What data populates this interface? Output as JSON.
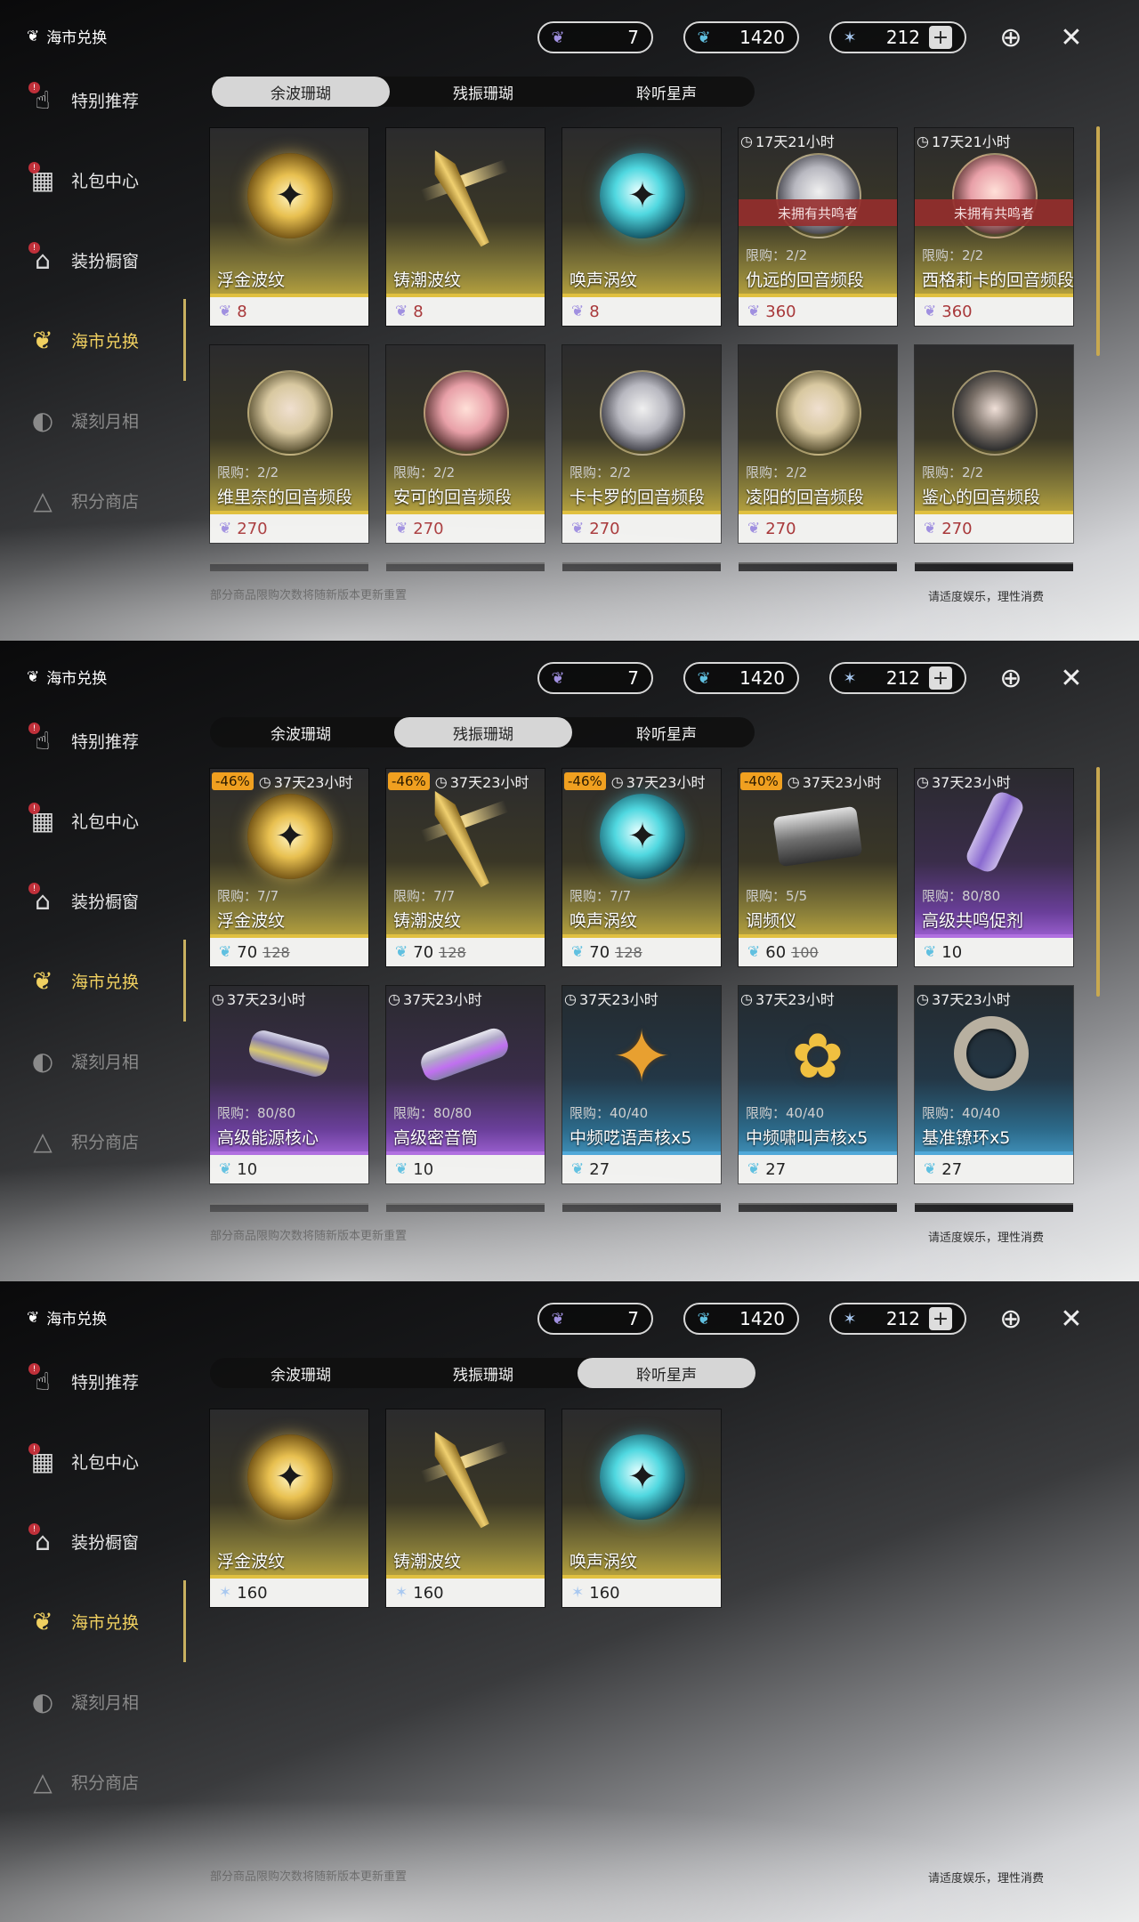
{
  "sidebar": {
    "title": "海市兑换",
    "items": [
      {
        "label": "特别推荐",
        "icon": "star-hand-icon",
        "badge": "!"
      },
      {
        "label": "礼包中心",
        "icon": "gift-icon",
        "badge": "!"
      },
      {
        "label": "装扮橱窗",
        "icon": "wardrobe-icon",
        "badge": "!"
      },
      {
        "label": "海市兑换",
        "icon": "coral-icon",
        "badge": ""
      },
      {
        "label": "凝刻月相",
        "icon": "moon-icon",
        "badge": ""
      },
      {
        "label": "积分商店",
        "icon": "triangle-shop-icon",
        "badge": ""
      }
    ],
    "active_index": 3
  },
  "currencies": [
    {
      "name": "余波珊瑚",
      "icon": "coral-purple-icon",
      "value": "7"
    },
    {
      "name": "残振珊瑚",
      "icon": "coral-blue-icon",
      "value": "1420"
    },
    {
      "name": "星声",
      "icon": "astrite-icon",
      "value": "212"
    }
  ],
  "plus_label": "+",
  "top_icons": [
    "target-icon",
    "close-icon"
  ],
  "tabs": [
    "余波珊瑚",
    "残振珊瑚",
    "聆听星声"
  ],
  "footer": {
    "left": "部分商品限购次数将随新版本更新重置",
    "right": "请适度娱乐，理性消费"
  },
  "colors": {
    "accent": "#f0d060",
    "discount": "#f0a020",
    "warning": "#963030",
    "price_red": "#a8383a"
  },
  "panels": [
    {
      "active_tab": 0,
      "items": [
        {
          "name": "浮金波纹",
          "price": "8",
          "price_red": true,
          "art": "gold-orb",
          "rarity": "gold"
        },
        {
          "name": "铸潮波纹",
          "price": "8",
          "price_red": true,
          "art": "blade",
          "rarity": "gold"
        },
        {
          "name": "唤声涡纹",
          "price": "8",
          "price_red": true,
          "art": "teal-orb",
          "rarity": "gold"
        },
        {
          "name": "仇远的回音频段",
          "price": "360",
          "price_red": true,
          "art": "portrait-grey",
          "rarity": "gold",
          "timer": "17天21小时",
          "limit": "限购：2/2",
          "warning": "未拥有共鸣者"
        },
        {
          "name": "西格莉卡的回音频段",
          "price": "360",
          "price_red": true,
          "art": "portrait-warm",
          "rarity": "gold",
          "timer": "17天21小时",
          "limit": "限购：2/2",
          "warning": "未拥有共鸣者"
        },
        {
          "name": "维里奈的回音频段",
          "price": "270",
          "price_red": true,
          "art": "portrait",
          "rarity": "gold",
          "limit": "限购：2/2"
        },
        {
          "name": "安可的回音频段",
          "price": "270",
          "price_red": true,
          "art": "portrait-warm",
          "rarity": "gold",
          "limit": "限购：2/2"
        },
        {
          "name": "卡卡罗的回音频段",
          "price": "270",
          "price_red": true,
          "art": "portrait-grey",
          "rarity": "gold",
          "limit": "限购：2/2"
        },
        {
          "name": "凌阳的回音频段",
          "price": "270",
          "price_red": true,
          "art": "portrait",
          "rarity": "gold",
          "limit": "限购：2/2"
        },
        {
          "name": "鉴心的回音频段",
          "price": "270",
          "price_red": true,
          "art": "portrait-dark",
          "rarity": "gold",
          "limit": "限购：2/2"
        }
      ]
    },
    {
      "active_tab": 1,
      "items": [
        {
          "name": "浮金波纹",
          "price": "70",
          "old_price": "128",
          "discount": "-46%",
          "timer": "37天23小时",
          "limit": "限购：7/7",
          "art": "gold-orb",
          "rarity": "gold"
        },
        {
          "name": "铸潮波纹",
          "price": "70",
          "old_price": "128",
          "discount": "-46%",
          "timer": "37天23小时",
          "limit": "限购：7/7",
          "art": "blade",
          "rarity": "gold"
        },
        {
          "name": "唤声涡纹",
          "price": "70",
          "old_price": "128",
          "discount": "-46%",
          "timer": "37天23小时",
          "limit": "限购：7/7",
          "art": "teal-orb",
          "rarity": "gold"
        },
        {
          "name": "调频仪",
          "price": "60",
          "old_price": "100",
          "discount": "-40%",
          "timer": "37天23小时",
          "limit": "限购：5/5",
          "art": "device",
          "rarity": "gold"
        },
        {
          "name": "高级共鸣促剂",
          "price": "10",
          "timer": "37天23小时",
          "limit": "限购：80/80",
          "art": "tube",
          "rarity": "purple"
        },
        {
          "name": "高级能源核心",
          "price": "10",
          "timer": "37天23小时",
          "limit": "限购：80/80",
          "art": "cylinder",
          "rarity": "purple"
        },
        {
          "name": "高级密音筒",
          "price": "10",
          "timer": "37天23小时",
          "limit": "限购：80/80",
          "art": "cylinder2",
          "rarity": "purple"
        },
        {
          "name": "中频呓语声核x5",
          "price": "27",
          "timer": "37天23小时",
          "limit": "限购：40/40",
          "art": "star4",
          "rarity": "blue"
        },
        {
          "name": "中频啸叫声核x5",
          "price": "27",
          "timer": "37天23小时",
          "limit": "限购：40/40",
          "art": "flower",
          "rarity": "blue"
        },
        {
          "name": "基准镣环x5",
          "price": "27",
          "timer": "37天23小时",
          "limit": "限购：40/40",
          "art": "ring",
          "rarity": "blue"
        }
      ]
    },
    {
      "active_tab": 2,
      "items": [
        {
          "name": "浮金波纹",
          "price": "160",
          "art": "gold-orb",
          "rarity": "gold",
          "price_icon": "astrite-icon"
        },
        {
          "name": "铸潮波纹",
          "price": "160",
          "art": "blade",
          "rarity": "gold",
          "price_icon": "astrite-icon"
        },
        {
          "name": "唤声涡纹",
          "price": "160",
          "art": "teal-orb",
          "rarity": "gold",
          "price_icon": "astrite-icon"
        }
      ]
    }
  ]
}
